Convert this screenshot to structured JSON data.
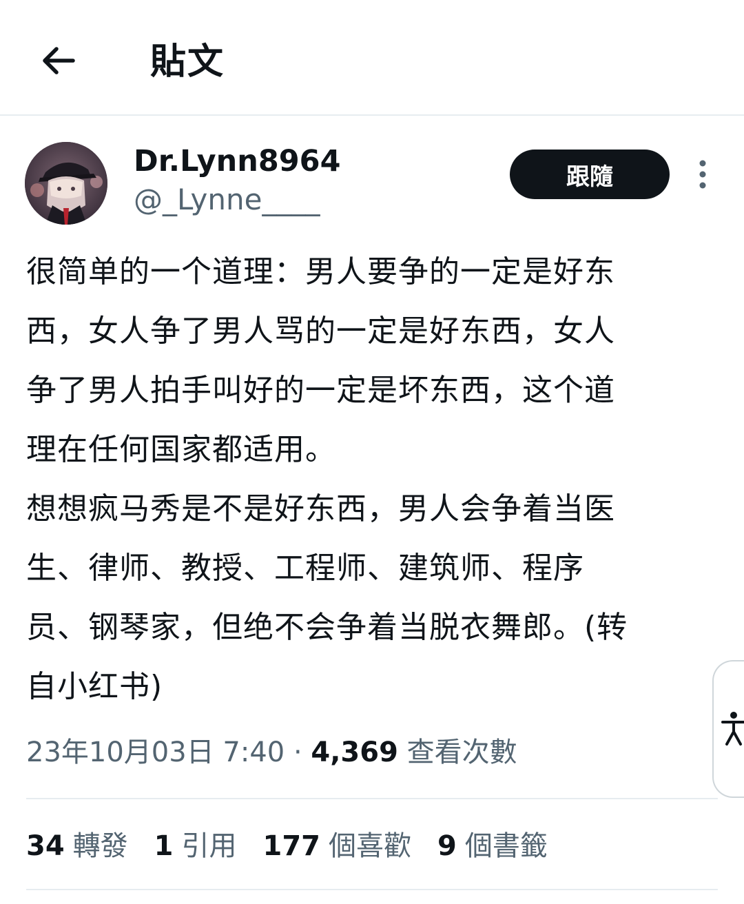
{
  "header": {
    "back_icon": "arrow-left-icon",
    "title": "貼文"
  },
  "author": {
    "display_name": "Dr.Lynn8964",
    "handle": "@_Lynne____",
    "follow_label": "跟隨",
    "more_icon": "more-vertical-icon"
  },
  "post": {
    "text": "很简单的一个道理：男人要争的一定是好东\n西，女人争了男人骂的一定是好东西，女人\n争了男人拍手叫好的一定是坏东西，这个道\n理在任何国家都适用。\n想想疯马秀是不是好东西，男人会争着当医\n生、律师、教授、工程师、建筑师、程序\n员、钢琴家，但绝不会争着当脱衣舞郎。(转\n自小红书)",
    "timestamp": "23年10月03日 7:40",
    "separator": " · ",
    "views_count": "4,369",
    "views_label": " 查看次數"
  },
  "stats": {
    "retweets": {
      "num": "34",
      "label": "轉發"
    },
    "quotes": {
      "num": "1",
      "label": "引用"
    },
    "likes": {
      "num": "177",
      "label": "個喜歡"
    },
    "bookmarks": {
      "num": "9",
      "label": "個書籤"
    }
  },
  "accessibility_icon": "accessibility-icon",
  "colors": {
    "text": "#0f1419",
    "secondary": "#536471",
    "divider": "#e6ecf0",
    "button_bg": "#0f1419"
  }
}
